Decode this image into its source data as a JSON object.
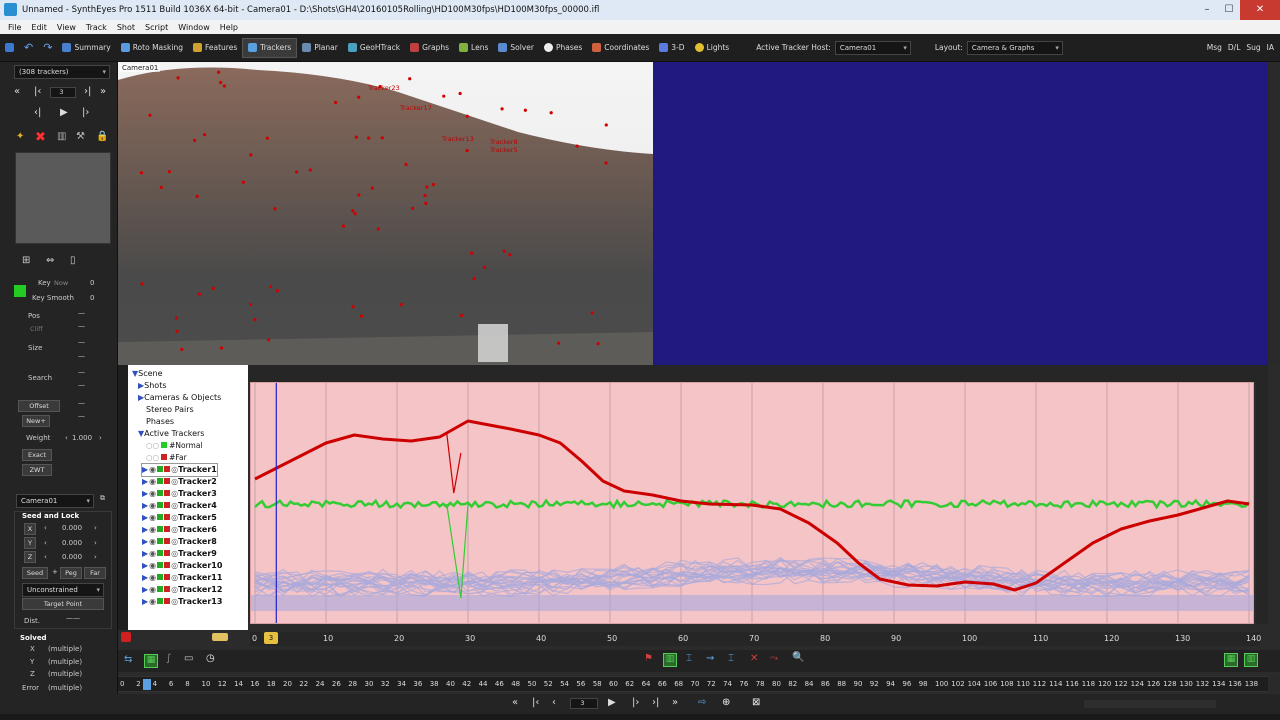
{
  "window": {
    "title": "Unnamed - SynthEyes Pro 1511 Build 1036X 64-bit - Camera01 - D:\\Shots\\GH4\\20160105Rolling\\HD100M30fps\\HD100M30fps_00000.ifl",
    "min": "–",
    "max": "☐",
    "close": "✕"
  },
  "menu": [
    "File",
    "Edit",
    "View",
    "Track",
    "Shot",
    "Script",
    "Window",
    "Help"
  ],
  "toolbar": {
    "rooms": [
      "Summary",
      "Roto Masking",
      "Features",
      "Trackers",
      "Planar",
      "GeoHTrack",
      "Graphs",
      "Lens",
      "Solver",
      "Phases",
      "Coordinates",
      "3-D",
      "Lights"
    ],
    "active_room": "Trackers",
    "active_tracker_host_label": "Active Tracker Host:",
    "active_tracker_host_value": "Camera01",
    "layout_label": "Layout:",
    "layout_value": "Camera & Graphs",
    "right_buttons": [
      "Msg",
      "D/L",
      "Sug",
      "IA"
    ]
  },
  "left_panel": {
    "tracker_select": "(308 trackers)",
    "frame_value": "3",
    "key_label": "Key",
    "key_now": "Now",
    "key_value": "0",
    "key_smooth_label": "Key Smooth",
    "key_smooth_value": "0",
    "pos_label": "Pos",
    "cliff_label": "Cliff",
    "size_label": "Size",
    "search_label": "Search",
    "offset_label": "Offset",
    "new_label": "New+",
    "weight_label": "Weight",
    "weight_value": "1.000",
    "exact_label": "Exact",
    "zwt_label": "ZWT",
    "camera_select": "Camera01",
    "seed_lock_title": "Seed and Lock",
    "x_label": "X",
    "y_label": "Y",
    "z_label": "Z",
    "x_value": "0.000",
    "y_value": "0.000",
    "z_value": "0.000",
    "seed_label": "Seed",
    "peg_label": "Peg",
    "far_label": "Far",
    "constraint_select": "Unconstrained",
    "target_point_label": "Target Point",
    "dist_label": "Dist.",
    "solved_label": "Solved",
    "solved_x": "(multiple)",
    "solved_y": "(multiple)",
    "solved_z": "(multiple)",
    "error_label": "Error",
    "error_value": "(multiple)"
  },
  "viewer": {
    "camera_label": "Camera01",
    "tracker_labels": [
      "Tracker23",
      "Tracker17",
      "Tracker13",
      "Tracker8",
      "Tracker5"
    ]
  },
  "hierarchy": {
    "scene": "Scene",
    "shots": "Shots",
    "cameras_objects": "Cameras & Objects",
    "stereo_pairs": "Stereo Pairs",
    "phases": "Phases",
    "active_trackers": "Active Trackers",
    "normal_group": "#Normal",
    "far_group": "#Far",
    "trackers": [
      "Tracker1",
      "Tracker2",
      "Tracker3",
      "Tracker4",
      "Tracker5",
      "Tracker6",
      "Tracker8",
      "Tracker9",
      "Tracker10",
      "Tracker11",
      "Tracker12",
      "Tracker13"
    ]
  },
  "graph": {
    "colors": {
      "background": "#f4c4c6",
      "red_curve": "#cc0000",
      "green_curve": "#33cc33",
      "blue_band": "#a9a9dc",
      "cursor": "#2222cc"
    },
    "current_frame": 3,
    "ruler_labels": [
      "0",
      "10",
      "20",
      "30",
      "40",
      "50",
      "60",
      "70",
      "80",
      "90",
      "100",
      "110",
      "120",
      "130",
      "140"
    ]
  },
  "timeline": {
    "current_frame": "3",
    "labels": [
      "0",
      "2",
      "4",
      "6",
      "8",
      "10",
      "12",
      "14",
      "16",
      "18",
      "20",
      "22",
      "24",
      "26",
      "28",
      "30",
      "32",
      "34",
      "36",
      "38",
      "40",
      "42",
      "44",
      "46",
      "48",
      "50",
      "52",
      "54",
      "56",
      "58",
      "60",
      "62",
      "64",
      "66",
      "68",
      "70",
      "72",
      "74",
      "76",
      "78",
      "80",
      "82",
      "84",
      "86",
      "88",
      "90",
      "92",
      "94",
      "96",
      "98",
      "100",
      "102",
      "104",
      "106",
      "108",
      "110",
      "112",
      "114",
      "116",
      "118",
      "120",
      "122",
      "124",
      "126",
      "128",
      "130",
      "132",
      "134",
      "136",
      "138"
    ]
  },
  "playbar": {
    "frame_value": "3"
  }
}
